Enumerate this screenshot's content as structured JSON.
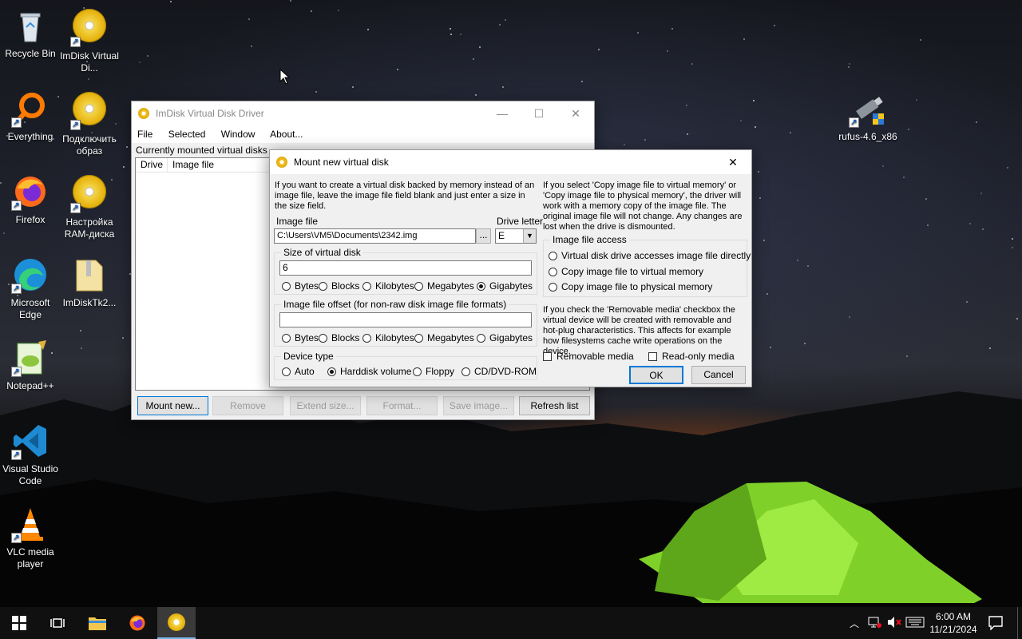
{
  "desktop": {
    "icons": [
      {
        "label": "Recycle Bin",
        "icon": "recycle-bin-icon"
      },
      {
        "label": "ImDisk Virtual Di...",
        "icon": "imdisk-icon"
      },
      {
        "label": "Everything",
        "icon": "everything-icon"
      },
      {
        "label": "Подключить образ",
        "icon": "imdisk-icon"
      },
      {
        "label": "Firefox",
        "icon": "firefox-icon"
      },
      {
        "label": "Настройка RAM-диска",
        "icon": "imdisk-icon"
      },
      {
        "label": "Microsoft Edge",
        "icon": "edge-icon"
      },
      {
        "label": "ImDiskTk2...",
        "icon": "folder-zip-icon"
      },
      {
        "label": "Notepad++",
        "icon": "notepadpp-icon"
      },
      {
        "label": "Visual Studio Code",
        "icon": "vscode-icon"
      },
      {
        "label": "VLC media player",
        "icon": "vlc-icon"
      },
      {
        "label": "rufus-4.6_x86",
        "icon": "usb-drive-icon"
      }
    ]
  },
  "imdisk_window": {
    "title": "ImDisk Virtual Disk Driver",
    "menu": [
      "File",
      "Selected",
      "Window",
      "About..."
    ],
    "list_caption": "Currently mounted virtual disks",
    "columns": [
      "Drive",
      "Image file"
    ],
    "buttons": {
      "mount": "Mount new...",
      "remove": "Remove",
      "extend": "Extend size...",
      "format": "Format...",
      "save": "Save image...",
      "refresh": "Refresh list"
    }
  },
  "mount_dialog": {
    "title": "Mount new virtual disk",
    "intro": "If you want to create a virtual disk backed by memory instead of an image file, leave the image file field blank and just enter a size in the size field.",
    "image_file_label": "Image file",
    "image_file_value": "C:\\Users\\VM5\\Documents\\2342.img",
    "browse_label": "...",
    "drive_letter_label": "Drive letter",
    "drive_letter_value": "E",
    "size_group": "Size of virtual disk",
    "size_value": "6",
    "units": [
      "Bytes",
      "Blocks",
      "Kilobytes",
      "Megabytes",
      "Gigabytes"
    ],
    "size_unit_selected": "Gigabytes",
    "offset_group": "Image file offset (for non-raw disk image file formats)",
    "offset_value": "",
    "device_type_group": "Device type",
    "device_types": [
      "Auto",
      "Harddisk volume",
      "Floppy",
      "CD/DVD-ROM"
    ],
    "device_type_selected": "Harddisk volume",
    "copy_info": "If you select 'Copy image file to virtual memory' or 'Copy image file to physical memory', the driver will work with a memory copy of the image file. The original image file will not change. Any changes are lost when the drive is dismounted.",
    "access_group": "Image file access",
    "access_options": [
      "Virtual disk drive accesses image file directly",
      "Copy image file to virtual memory",
      "Copy image file to physical memory"
    ],
    "removable_info": "If you check the 'Removable media' checkbox the virtual device will be created with removable and hot-plug characteristics. This affects for example how filesystems cache write operations on the device.",
    "removable_label": "Removable media",
    "readonly_label": "Read-only media",
    "ok_label": "OK",
    "cancel_label": "Cancel"
  },
  "taskbar": {
    "time": "6:00 AM",
    "date": "11/21/2024"
  }
}
